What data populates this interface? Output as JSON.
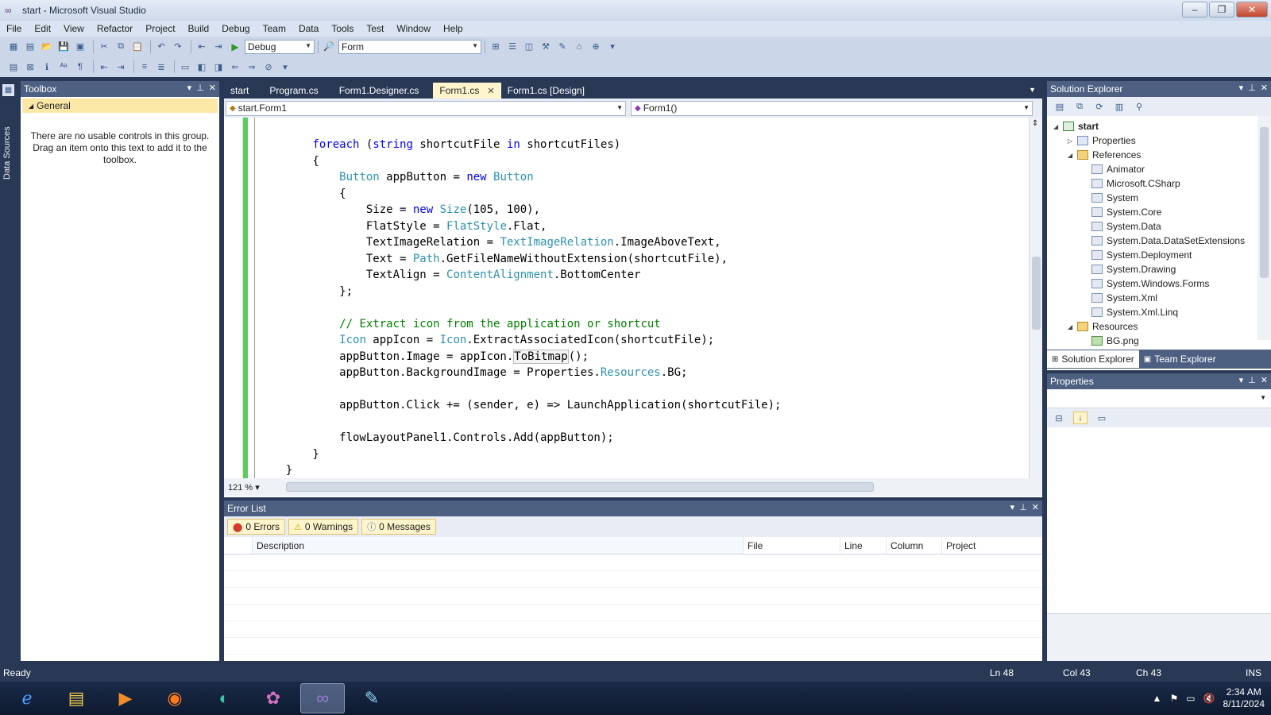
{
  "window": {
    "title": "start - Microsoft Visual Studio"
  },
  "menu": [
    "File",
    "Edit",
    "View",
    "Refactor",
    "Project",
    "Build",
    "Debug",
    "Team",
    "Data",
    "Tools",
    "Test",
    "Window",
    "Help"
  ],
  "toolbar": {
    "configuration": "Debug",
    "find_combo": "Form"
  },
  "side_strip": {
    "label": "Data Sources"
  },
  "toolbox": {
    "title": "Toolbox",
    "group": "General",
    "empty_message": "There are no usable controls in this group. Drag an item onto this text to add it to the toolbox."
  },
  "editor": {
    "tabs": [
      {
        "label": "start",
        "active": false
      },
      {
        "label": "Program.cs",
        "active": false
      },
      {
        "label": "Form1.Designer.cs",
        "active": false
      },
      {
        "label": "Form1.cs",
        "active": true
      },
      {
        "label": "Form1.cs [Design]",
        "active": false
      }
    ],
    "class_combo": "start.Form1",
    "member_combo": "Form1()",
    "zoom": "121 %"
  },
  "error_list": {
    "title": "Error List",
    "errors": "0 Errors",
    "warnings": "0 Warnings",
    "messages": "0 Messages",
    "columns": [
      "Description",
      "File",
      "Line",
      "Column",
      "Project"
    ]
  },
  "solution_explorer": {
    "title": "Solution Explorer",
    "project": "start",
    "properties": "Properties",
    "references_folder": "References",
    "references": [
      "Animator",
      "Microsoft.CSharp",
      "System",
      "System.Core",
      "System.Data",
      "System.Data.DataSetExtensions",
      "System.Deployment",
      "System.Drawing",
      "System.Windows.Forms",
      "System.Xml",
      "System.Xml.Linq"
    ],
    "resources_folder": "Resources",
    "resources": [
      "BG.png"
    ],
    "tab_solution": "Solution Explorer",
    "tab_team": "Team Explorer"
  },
  "properties_panel": {
    "title": "Properties"
  },
  "status": {
    "text": "Ready",
    "line": "Ln 48",
    "col": "Col 43",
    "ch": "Ch 43",
    "mode": "INS"
  },
  "taskbar": {
    "time": "2:34 AM",
    "date": "8/11/2024"
  },
  "colors": {
    "chrome": "#293955",
    "active_tab": "#fff5cc",
    "keyword": "#0000ff",
    "type": "#2b91af",
    "comment": "#008000"
  }
}
